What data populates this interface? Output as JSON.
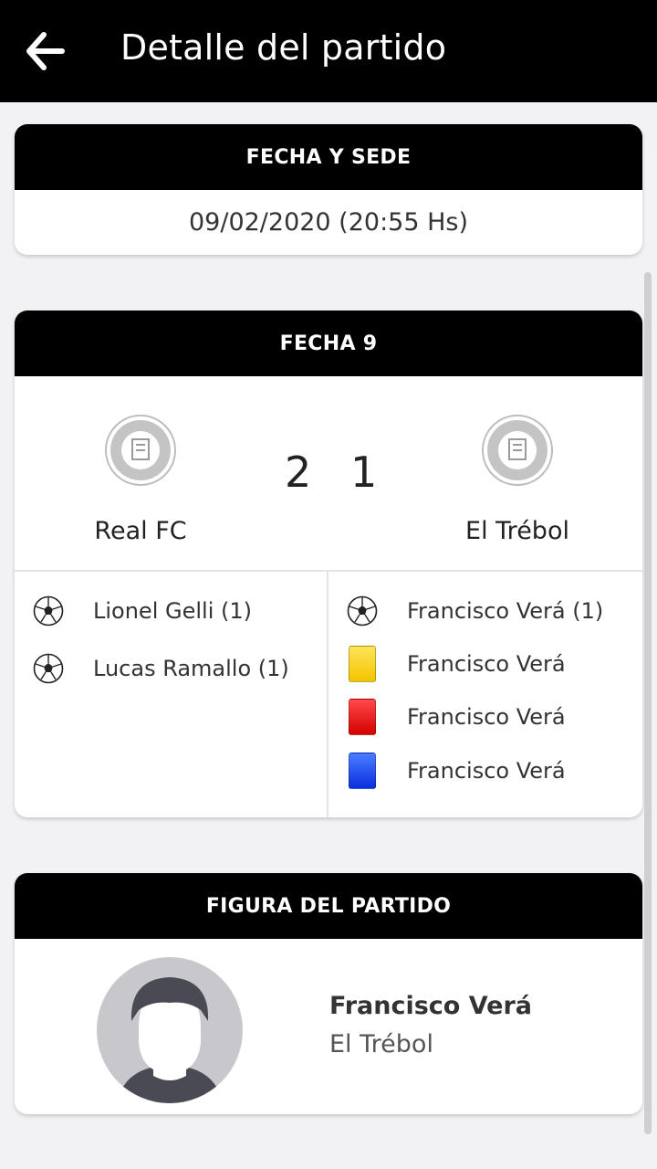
{
  "appbar": {
    "title": "Detalle del partido",
    "back_icon": "arrow-left-icon"
  },
  "date_card": {
    "header": "FECHA Y SEDE",
    "datetime": "09/02/2020 (20:55 Hs)"
  },
  "match_card": {
    "header": "FECHA 9",
    "home": {
      "name": "Real FC",
      "score": "2",
      "crest_icon": "league-crest-icon"
    },
    "away": {
      "name": "El Trébol",
      "score": "1",
      "crest_icon": "league-crest-icon"
    },
    "home_events": [
      {
        "type": "goal",
        "icon": "soccer-ball-icon",
        "text": "Lionel Gelli (1)"
      },
      {
        "type": "goal",
        "icon": "soccer-ball-icon",
        "text": "Lucas Ramallo (1)"
      }
    ],
    "away_events": [
      {
        "type": "goal",
        "icon": "soccer-ball-icon",
        "text": "Francisco Verá (1)"
      },
      {
        "type": "yellow",
        "icon": "yellow-card-icon",
        "text": "Francisco Verá"
      },
      {
        "type": "red",
        "icon": "red-card-icon",
        "text": "Francisco Verá"
      },
      {
        "type": "blue",
        "icon": "blue-card-icon",
        "text": "Francisco Verá"
      }
    ]
  },
  "mvp_card": {
    "header": "FIGURA DEL PARTIDO",
    "player_name": "Francisco Verá",
    "player_team": "El Trébol"
  },
  "colors": {
    "header_bg": "#000000",
    "yellow_card": "#f2c400",
    "red_card": "#e00000",
    "blue_card": "#1a3ff0"
  }
}
